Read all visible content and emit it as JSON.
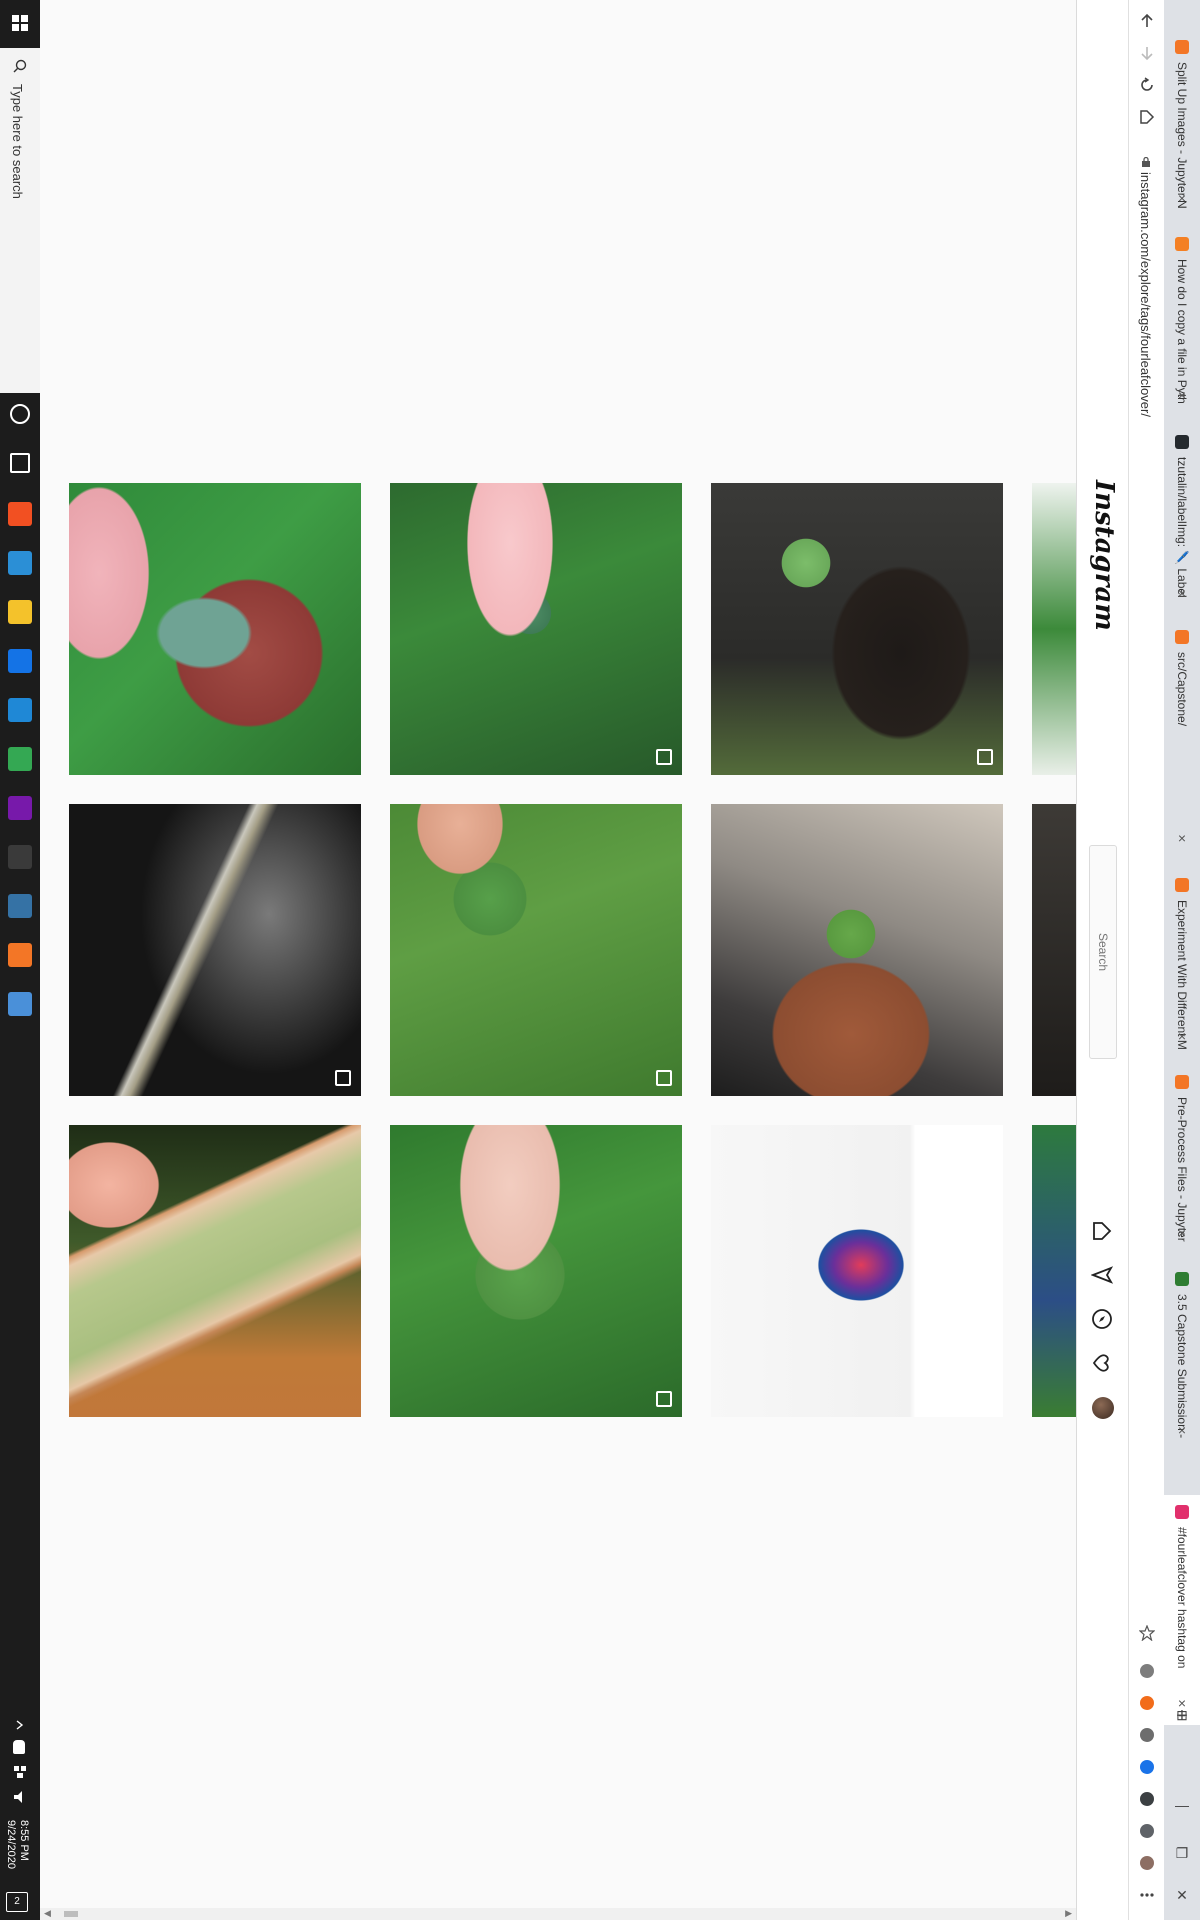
{
  "taskbar": {
    "search_placeholder": "Type here to search",
    "clock_time": "8:55 PM",
    "clock_date": "9/24/2020",
    "notification_count": "2",
    "pinned_apps": [
      {
        "name": "cortana-icon",
        "color": "#ffffff"
      },
      {
        "name": "task-view-icon",
        "color": "#ffffff"
      },
      {
        "name": "microsoft-store-icon",
        "color": "#f25022"
      },
      {
        "name": "edge-icon",
        "color": "#2b8fd6"
      },
      {
        "name": "file-explorer-icon",
        "color": "#f4c22b"
      },
      {
        "name": "photoshop-icon",
        "color": "#1473e6"
      },
      {
        "name": "visual-studio-code-icon",
        "color": "#1f88d6"
      },
      {
        "name": "chrome-icon",
        "color": "#34a853"
      },
      {
        "name": "onenote-icon",
        "color": "#7719aa"
      },
      {
        "name": "kindle-icon",
        "color": "#3a3a3a"
      },
      {
        "name": "python-icon",
        "color": "#3572a5"
      },
      {
        "name": "jupyter-icon",
        "color": "#f37626"
      },
      {
        "name": "calculator-icon",
        "color": "#4a90d9"
      }
    ]
  },
  "browser": {
    "url": "instagram.com/explore/tags/fourleafclover/",
    "tabs": [
      {
        "title": "Split Up Images - Jupyter N",
        "favicon_color": "#f37626",
        "active": false
      },
      {
        "title": "How do I copy a file in Pyth",
        "favicon_color": "#f48024",
        "active": false
      },
      {
        "title": "tzutalin/labelImg: 🖊️ Label",
        "favicon_color": "#24292e",
        "active": false
      },
      {
        "title": "src/Capstone/",
        "favicon_color": "#f37626",
        "active": false
      },
      {
        "title": "Experiment With Different M",
        "favicon_color": "#f37626",
        "active": false
      },
      {
        "title": "Pre-Process Files - Jupyter",
        "favicon_color": "#f37626",
        "active": false
      },
      {
        "title": "3.5 Capstone Submission -",
        "favicon_color": "#2e7d32",
        "active": false
      },
      {
        "title": "#fourleafclover hashtag on",
        "favicon_color": "#e1306c",
        "active": true
      }
    ],
    "extensions": [
      {
        "name": "grammarly-extension-icon",
        "color": "#7d7d7d"
      },
      {
        "name": "honey-extension-icon",
        "color": "#f26c1a"
      },
      {
        "name": "dark-mode-extension-icon",
        "color": "#6d6d6d"
      },
      {
        "name": "b-extension-icon",
        "color": "#1a73e8"
      },
      {
        "name": "screenshot-extension-icon",
        "color": "#3c4043"
      },
      {
        "name": "puzzle-extensions-icon",
        "color": "#5f6368"
      },
      {
        "name": "profile-avatar-icon",
        "color": "#8d6e63"
      }
    ]
  },
  "instagram": {
    "logo": "Instagram",
    "search_placeholder": "Search"
  },
  "grid": {
    "tiles": [
      {
        "name": "tile-dog-with-clover",
        "multi": false,
        "bg": "radial-gradient(ellipse 80px 60px at 135px 150px,#6fa394 0%,#6fa394 55%,transparent 60%),radial-gradient(ellipse 120px 120px at 180px 170px,#a24c45 0%,#8e3a36 60%,transparent 62%),radial-gradient(ellipse 70px 120px at 30px 90px,#f1b4bb 0%,#e8a3ab 70%,transparent 72%),linear-gradient(135deg,#2f8a3a,#3e9d45 45%,#2a6d2c)"
      },
      {
        "name": "tile-hand-clover-grass",
        "multi": true,
        "bg": "radial-gradient(ellipse 60px 130px at 120px 60px,#f8c9cc 0%,#f3b7bb 70%,transparent 72%),radial-gradient(circle 26px at 140px 130px,#4f8e67 0%,#3f7b56 80%,transparent 82%),linear-gradient(160deg,#2d6a2f,#3b8a3a 40%,#27592a)"
      },
      {
        "name": "tile-puppy-clover",
        "multi": true,
        "bg": "radial-gradient(circle 30px at 95px 80px,#7cbd6a 0%,#6aa95a 80%,transparent 82%),radial-gradient(ellipse 120px 150px at 190px 170px,#1e1a18 0%,#26201c 55%,transparent 58%),radial-gradient(ellipse 70px 60px at 185px 205px,#eeeae6 0%,#d9d3ce 70%,transparent 72%),linear-gradient(180deg,#3a3a38,#2b2b29 60%,#536b3a)"
      },
      {
        "name": "tile-brooch-dark",
        "multi": true,
        "bg": "linear-gradient(115deg,transparent 42%,#c9c7bc 44%,#a49e86 46%,transparent 49%),radial-gradient(ellipse 160px 200px at 200px 110px,#7a7a7a 0%,#3a3a3a 50%,#151515 80%),linear-gradient(180deg,#2a2a2a,#0c0c0c)"
      },
      {
        "name": "tile-clover-close-grass",
        "multi": true,
        "bg": "radial-gradient(ellipse 60px 70px at 70px 20px,#e8b097 0%,#d99c82 70%,transparent 72%),radial-gradient(circle 45px at 100px 95px,#57a04a 0%,#4c8f40 80%,transparent 82%),linear-gradient(160deg,#4c8a36,#5f9e44 40%,#3f7a2e)"
      },
      {
        "name": "tile-hand-clover-car",
        "multi": false,
        "bg": "radial-gradient(circle 30px at 140px 130px,#66a84a 0%,#599a40 80%,transparent 82%),radial-gradient(ellipse 110px 100px at 140px 230px,#a05a3a 0%,#8c4d31 70%,transparent 72%),linear-gradient(200deg,#cfc7bc,#8f8a84 40%,#3e3c3c 75%,#1d1d1d)"
      },
      {
        "name": "tile-pressed-clover-frame",
        "multi": false,
        "bg": "linear-gradient(155deg,transparent 30%,#d79b6d 31%,#e7c9a9 33%,#b7c88c 40%,#a9bf80 55%,#e6c7a6 62%,#c58757 64%,transparent 66%),radial-gradient(ellipse 70px 60px at 40px 60px,#f3b4a1 0%,#e39d89 70%,transparent 72%),linear-gradient(180deg,#1f2d16,#3f5a2a 40%,#c07a38 80%,#c1773a)"
      },
      {
        "name": "tile-hand-clover-patch",
        "multi": true,
        "bg": "radial-gradient(ellipse 70px 120px at 120px 60px,#f2cdc0 0%,#e9bcae 70%,transparent 72%),radial-gradient(circle 55px at 130px 150px,#5aa34c 0%,#4f9242 80%,transparent 82%),linear-gradient(160deg,#2f7a2e,#45963c 40%,#2b6a2a)"
      },
      {
        "name": "tile-album-cover",
        "multi": true,
        "bg": "radial-gradient(ellipse 60px 50px at 150px 140px,#e13c5a 0%,#6a2f9a 45%,#1e4fa0 70%,transparent 72%),linear-gradient(90deg,#f7f7f7 0%,#f1f1f1 68%,#ffffff 70%,#ffffff 100%)"
      }
    ]
  }
}
